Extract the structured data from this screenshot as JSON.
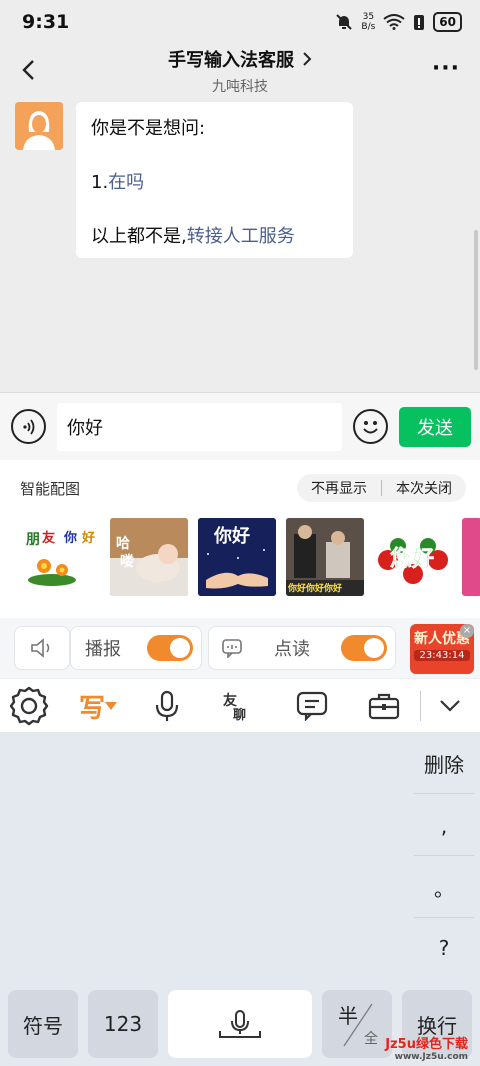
{
  "status": {
    "time": "9:31",
    "speed_value": "35",
    "speed_unit": "B/s",
    "battery": "60"
  },
  "header": {
    "title": "手写输入法客服",
    "subtitle": "九吨科技"
  },
  "chat": {
    "line1": "你是不是想问:",
    "option_prefix": "1.",
    "option_link": "在吗",
    "line3_prefix": "以上都不是,",
    "line3_link": "转接人工服务"
  },
  "input": {
    "value": "你好",
    "send_label": "发送"
  },
  "smart": {
    "label": "智能配图",
    "hide_label": "不再显示",
    "close_label": "本次关闭",
    "thumbs": [
      "朋友你好",
      "哈喽",
      "你好",
      "你好你好你好",
      "您好"
    ]
  },
  "toolbar1": {
    "broadcast_label": "播报",
    "read_label": "点读",
    "promo_title": "新人优惠",
    "promo_time": "23:43:14"
  },
  "toolbar2": {
    "write_label": "写"
  },
  "keyboard": {
    "delete": "删除",
    "comma": ",",
    "period": "。",
    "question": "?",
    "symbols": "符号",
    "numbers": "123",
    "half": "半",
    "full": "全",
    "enter": "换行"
  },
  "watermark": {
    "main": "Jz5u绿色下载",
    "sub": "www.Jz5u.com"
  },
  "colors": {
    "send_green": "#07c160",
    "toggle_orange": "#f08a2c",
    "link_blue": "#4a5f8c"
  }
}
